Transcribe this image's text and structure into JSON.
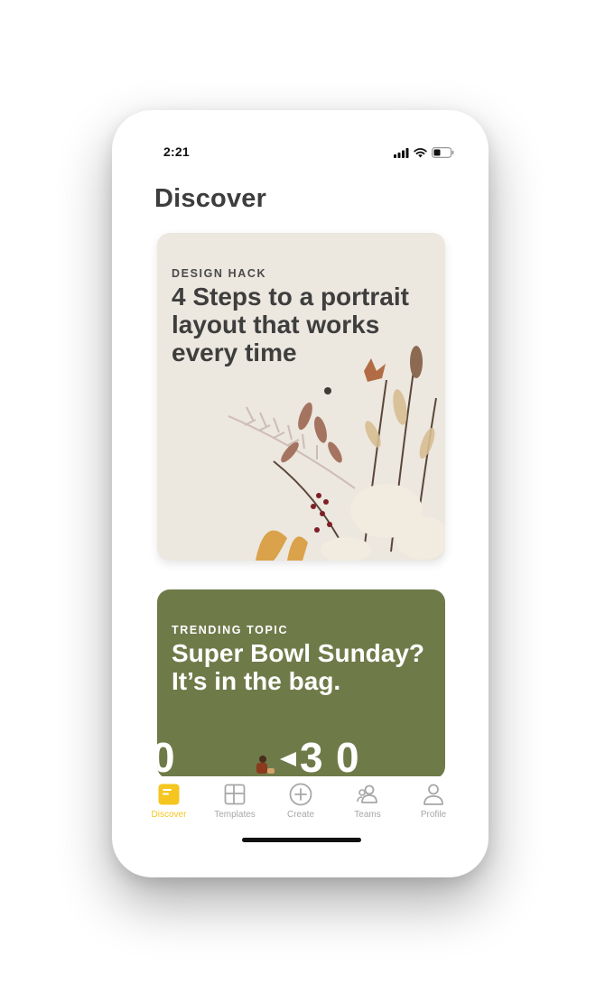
{
  "status_bar": {
    "time": "2:21"
  },
  "page": {
    "title": "Discover"
  },
  "cards": [
    {
      "eyebrow": "DESIGN HACK",
      "headline": "4 Steps to a portrait layout that works every time"
    },
    {
      "eyebrow": "TRENDING TOPIC",
      "headline": "Super Bowl Sunday? It’s in the bag.",
      "field_marking": "0  ◂30"
    }
  ],
  "tab_bar": {
    "active": "Discover",
    "accent_color": "#f4c61f",
    "tabs": [
      {
        "label": "Discover",
        "icon": "discover-icon"
      },
      {
        "label": "Templates",
        "icon": "templates-icon"
      },
      {
        "label": "Create",
        "icon": "create-plus-icon"
      },
      {
        "label": "Teams",
        "icon": "teams-icon"
      },
      {
        "label": "Profile",
        "icon": "profile-icon"
      }
    ]
  }
}
